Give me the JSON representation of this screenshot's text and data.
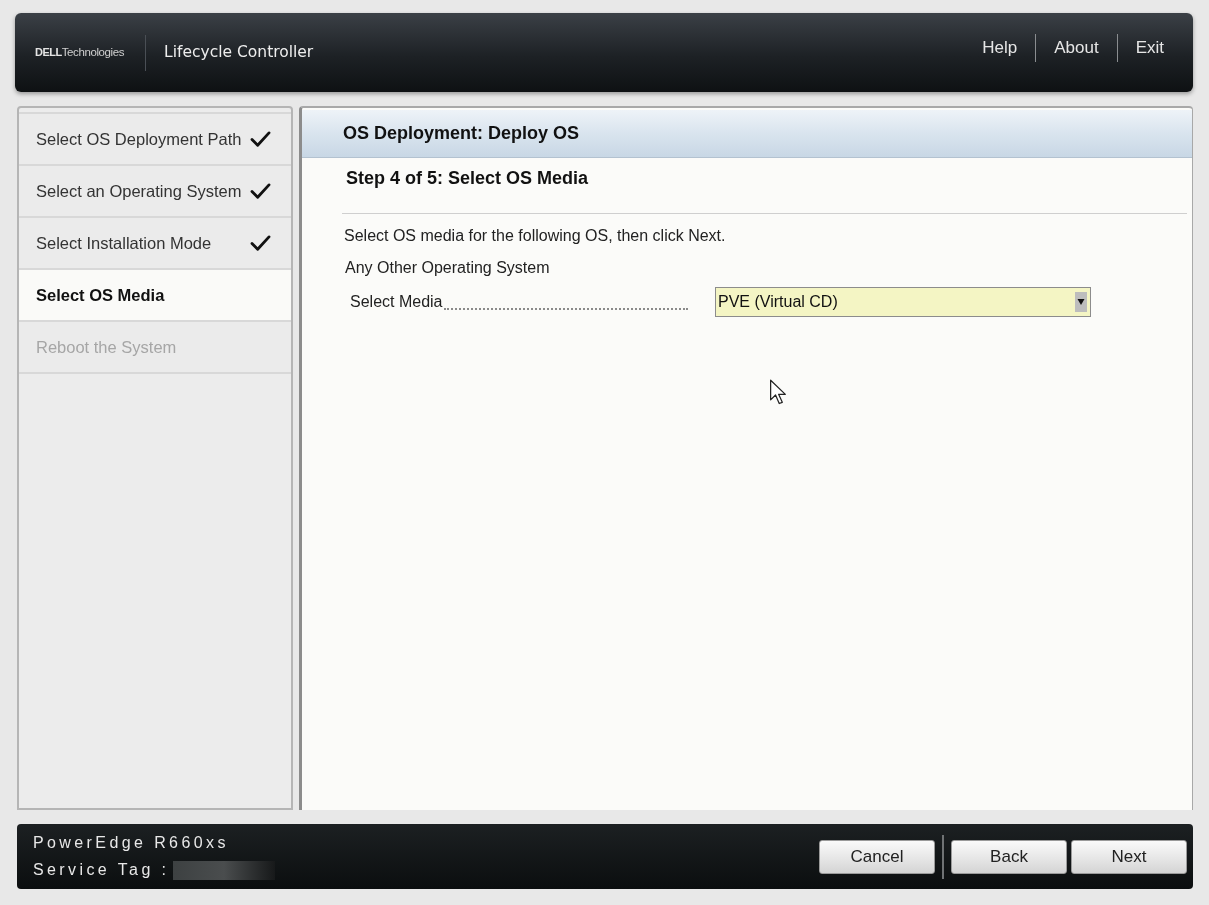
{
  "header": {
    "logo": {
      "brand": "DELL",
      "suffix": "Technologies"
    },
    "title": "Lifecycle Controller",
    "links": [
      "Help",
      "About",
      "Exit"
    ]
  },
  "steps": [
    {
      "label": "Select OS Deployment Path",
      "completed": true,
      "selected": false,
      "disabled": false
    },
    {
      "label": "Select an Operating System",
      "completed": true,
      "selected": false,
      "disabled": false
    },
    {
      "label": "Select Installation Mode",
      "completed": true,
      "selected": false,
      "disabled": false
    },
    {
      "label": "Select OS Media",
      "completed": false,
      "selected": true,
      "disabled": false
    },
    {
      "label": "Reboot the System",
      "completed": false,
      "selected": false,
      "disabled": true
    }
  ],
  "panel": {
    "title": "OS Deployment: Deploy OS",
    "step_heading": "Step 4 of 5: Select OS Media",
    "instruction": "Select OS media for the following OS, then click Next.",
    "os_name": "Any Other Operating System",
    "media_field": {
      "label": "Select Media",
      "value": "PVE (Virtual CD)"
    }
  },
  "footer": {
    "model": "PowerEdge R660xs",
    "service_tag_label": "Service Tag :",
    "buttons": [
      "Cancel",
      "Back",
      "Next"
    ]
  }
}
